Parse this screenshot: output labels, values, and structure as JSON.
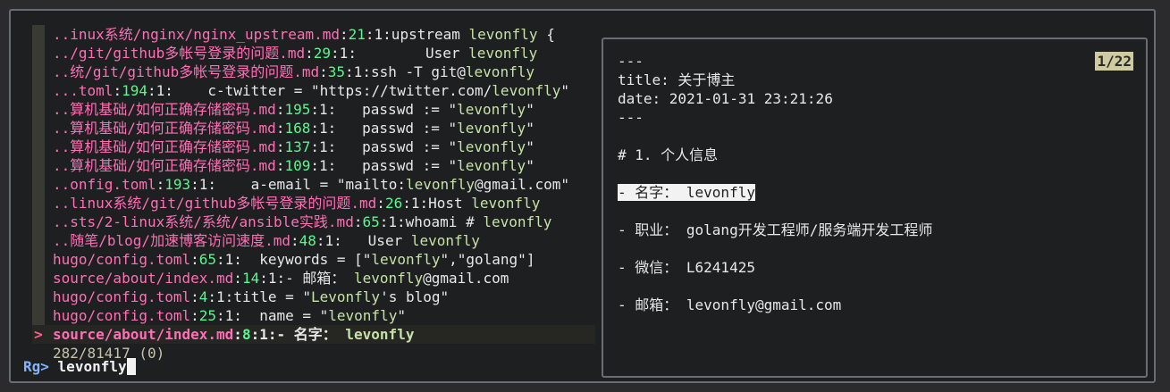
{
  "results": [
    {
      "parts": [
        [
          "pk",
          ".."
        ],
        [
          "pk",
          "inux系统/nginx/nginx_upstream.md"
        ],
        [
          "w",
          ":"
        ],
        [
          "num",
          "21"
        ],
        [
          "w",
          ":1:upstream "
        ],
        [
          "m",
          "levonfly"
        ],
        [
          "w",
          " {"
        ]
      ]
    },
    {
      "parts": [
        [
          "pk",
          ".."
        ],
        [
          "pk",
          "/git/github多帐号登录的问题.md"
        ],
        [
          "w",
          ":"
        ],
        [
          "num",
          "29"
        ],
        [
          "w",
          ":1:        User "
        ],
        [
          "m",
          "levonfly"
        ]
      ]
    },
    {
      "parts": [
        [
          "pk",
          ".."
        ],
        [
          "pk",
          "统/git/github多帐号登录的问题.md"
        ],
        [
          "w",
          ":"
        ],
        [
          "num",
          "35"
        ],
        [
          "w",
          ":1:ssh -T git@"
        ],
        [
          "m",
          "levonfly"
        ]
      ]
    },
    {
      "parts": [
        [
          "pk",
          ".."
        ],
        [
          "pk",
          ".toml"
        ],
        [
          "w",
          ":"
        ],
        [
          "num",
          "194"
        ],
        [
          "w",
          ":1:    c-twitter = \"https://twitter.com/"
        ],
        [
          "m",
          "levonfly"
        ],
        [
          "w",
          "\""
        ]
      ]
    },
    {
      "parts": [
        [
          "pk",
          ".."
        ],
        [
          "pk",
          "算机基础/如何正确存储密码.md"
        ],
        [
          "w",
          ":"
        ],
        [
          "num",
          "195"
        ],
        [
          "w",
          ":1:   passwd := \""
        ],
        [
          "m",
          "levonfly"
        ],
        [
          "w",
          "\""
        ]
      ]
    },
    {
      "parts": [
        [
          "pk",
          ".."
        ],
        [
          "pk",
          "算机基础/如何正确存储密码.md"
        ],
        [
          "w",
          ":"
        ],
        [
          "num",
          "168"
        ],
        [
          "w",
          ":1:   passwd := \""
        ],
        [
          "m",
          "levonfly"
        ],
        [
          "w",
          "\""
        ]
      ]
    },
    {
      "parts": [
        [
          "pk",
          ".."
        ],
        [
          "pk",
          "算机基础/如何正确存储密码.md"
        ],
        [
          "w",
          ":"
        ],
        [
          "num",
          "137"
        ],
        [
          "w",
          ":1:   passwd := \""
        ],
        [
          "m",
          "levonfly"
        ],
        [
          "w",
          "\""
        ]
      ]
    },
    {
      "parts": [
        [
          "pk",
          ".."
        ],
        [
          "pk",
          "算机基础/如何正确存储密码.md"
        ],
        [
          "w",
          ":"
        ],
        [
          "num",
          "109"
        ],
        [
          "w",
          ":1:   passwd := \""
        ],
        [
          "m",
          "levonfly"
        ],
        [
          "w",
          "\""
        ]
      ]
    },
    {
      "parts": [
        [
          "pk",
          ".."
        ],
        [
          "pk",
          "onfig.toml"
        ],
        [
          "w",
          ":"
        ],
        [
          "num",
          "193"
        ],
        [
          "w",
          ":1:    a-email = \"mailto:"
        ],
        [
          "m",
          "levonfly"
        ],
        [
          "w",
          "@gmail.com\""
        ]
      ]
    },
    {
      "parts": [
        [
          "pk",
          ".."
        ],
        [
          "pk",
          "linux系统/git/github多帐号登录的问题.md"
        ],
        [
          "w",
          ":"
        ],
        [
          "num",
          "26"
        ],
        [
          "w",
          ":1:Host "
        ],
        [
          "m",
          "levonfly"
        ]
      ]
    },
    {
      "parts": [
        [
          "pk",
          ".."
        ],
        [
          "pk",
          "sts/2-linux系统/系统/ansible实践.md"
        ],
        [
          "w",
          ":"
        ],
        [
          "num",
          "65"
        ],
        [
          "w",
          ":1:whoami # "
        ],
        [
          "m",
          "levonfly"
        ]
      ]
    },
    {
      "parts": [
        [
          "pk",
          ".."
        ],
        [
          "pk",
          "随笔/blog/加速博客访问速度.md"
        ],
        [
          "w",
          ":"
        ],
        [
          "num",
          "48"
        ],
        [
          "w",
          ":1:   User "
        ],
        [
          "m",
          "levonfly"
        ]
      ]
    },
    {
      "parts": [
        [
          "pk",
          "hugo/config.toml"
        ],
        [
          "w",
          ":"
        ],
        [
          "num",
          "65"
        ],
        [
          "w",
          ":1:  keywords = [\""
        ],
        [
          "m",
          "levonfly"
        ],
        [
          "w",
          "\",\"golang\"]"
        ]
      ]
    },
    {
      "parts": [
        [
          "pk",
          "source/about/index.md"
        ],
        [
          "w",
          ":"
        ],
        [
          "num",
          "14"
        ],
        [
          "w",
          ":1:- 邮箱： "
        ],
        [
          "m",
          "levonfly"
        ],
        [
          "w",
          "@gmail.com"
        ]
      ]
    },
    {
      "parts": [
        [
          "pk",
          "hugo/config.toml"
        ],
        [
          "w",
          ":"
        ],
        [
          "num",
          "4"
        ],
        [
          "w",
          ":1:title = \""
        ],
        [
          "m",
          "Levonfly"
        ],
        [
          "w",
          "'s blog\""
        ]
      ]
    },
    {
      "parts": [
        [
          "pk",
          "hugo/config.toml"
        ],
        [
          "w",
          ":"
        ],
        [
          "num",
          "25"
        ],
        [
          "w",
          ":1:  name = \""
        ],
        [
          "m",
          "levonfly"
        ],
        [
          "w",
          "\""
        ]
      ]
    }
  ],
  "selected": {
    "marker": ">",
    "parts": [
      [
        "pk",
        "source/about/index.md"
      ],
      [
        "w",
        ":"
      ],
      [
        "num",
        "8"
      ],
      [
        "w",
        ":1:- 名字： "
      ],
      [
        "m",
        "levonfly"
      ]
    ]
  },
  "match_count": "282/81417 (0)",
  "prompt_label": "Rg>",
  "query": "levonfly",
  "preview": {
    "position": "1/22",
    "lines": [
      "---",
      "title: 关于博主",
      "date: 2021-01-31 23:21:26",
      "---",
      "",
      "# 1. 个人信息",
      "",
      "- 名字： levonfly",
      "",
      "- 职业： golang开发工程师/服务端开发工程师",
      "",
      "- 微信： L6241425",
      "",
      "- 邮箱： levonfly@gmail.com"
    ],
    "highlighted_line": 7
  }
}
